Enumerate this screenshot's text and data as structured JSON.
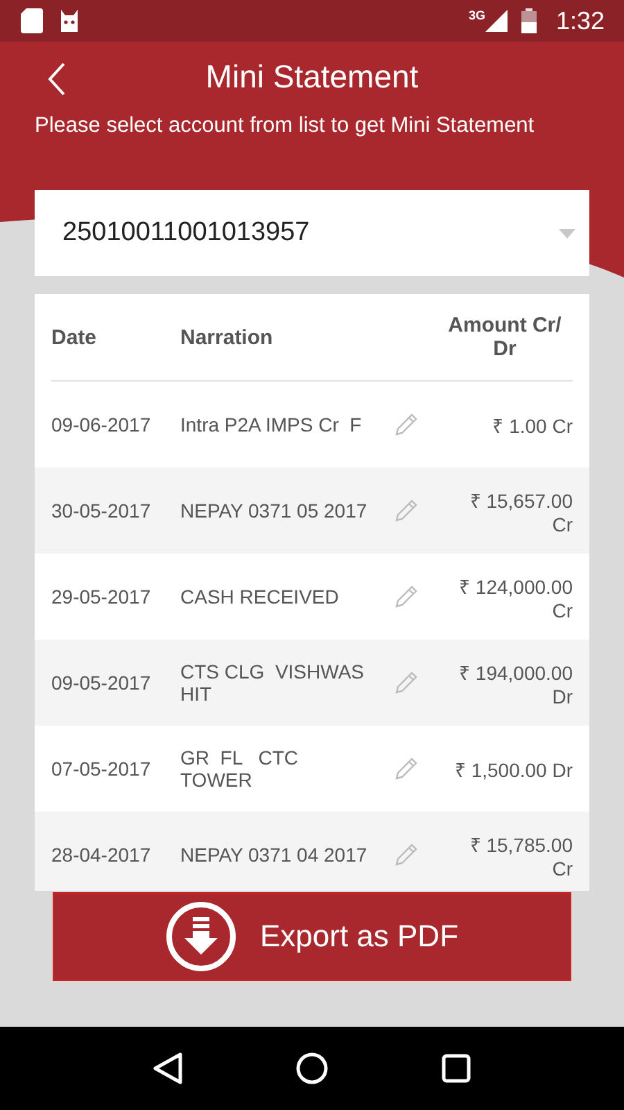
{
  "status_bar": {
    "network": "3G",
    "time": "1:32"
  },
  "header": {
    "title": "Mini Statement",
    "subtitle": "Please select account from list to get Mini Statement"
  },
  "account_dropdown": {
    "value": "25010011001013957"
  },
  "table": {
    "columns": [
      "Date",
      "Narration",
      "Amount Cr/ Dr"
    ],
    "rows": [
      {
        "date": "09-06-2017",
        "narration": "Intra P2A IMPS Cr  F",
        "amount": "₹ 1.00 Cr"
      },
      {
        "date": "30-05-2017",
        "narration": "NEPAY 0371 05 2017",
        "amount": "₹ 15,657.00 Cr"
      },
      {
        "date": "29-05-2017",
        "narration": "CASH RECEIVED",
        "amount": "₹ 124,000.00 Cr"
      },
      {
        "date": "09-05-2017",
        "narration": "CTS CLG  VISHWAS HIT",
        "amount": "₹ 194,000.00 Dr"
      },
      {
        "date": "07-05-2017",
        "narration": "GR  FL   CTC TOWER",
        "amount": "₹ 1,500.00 Dr"
      },
      {
        "date": "28-04-2017",
        "narration": "NEPAY 0371 04 2017",
        "amount": "₹ 15,785.00 Cr"
      }
    ]
  },
  "export_button": {
    "label": "Export as PDF"
  }
}
